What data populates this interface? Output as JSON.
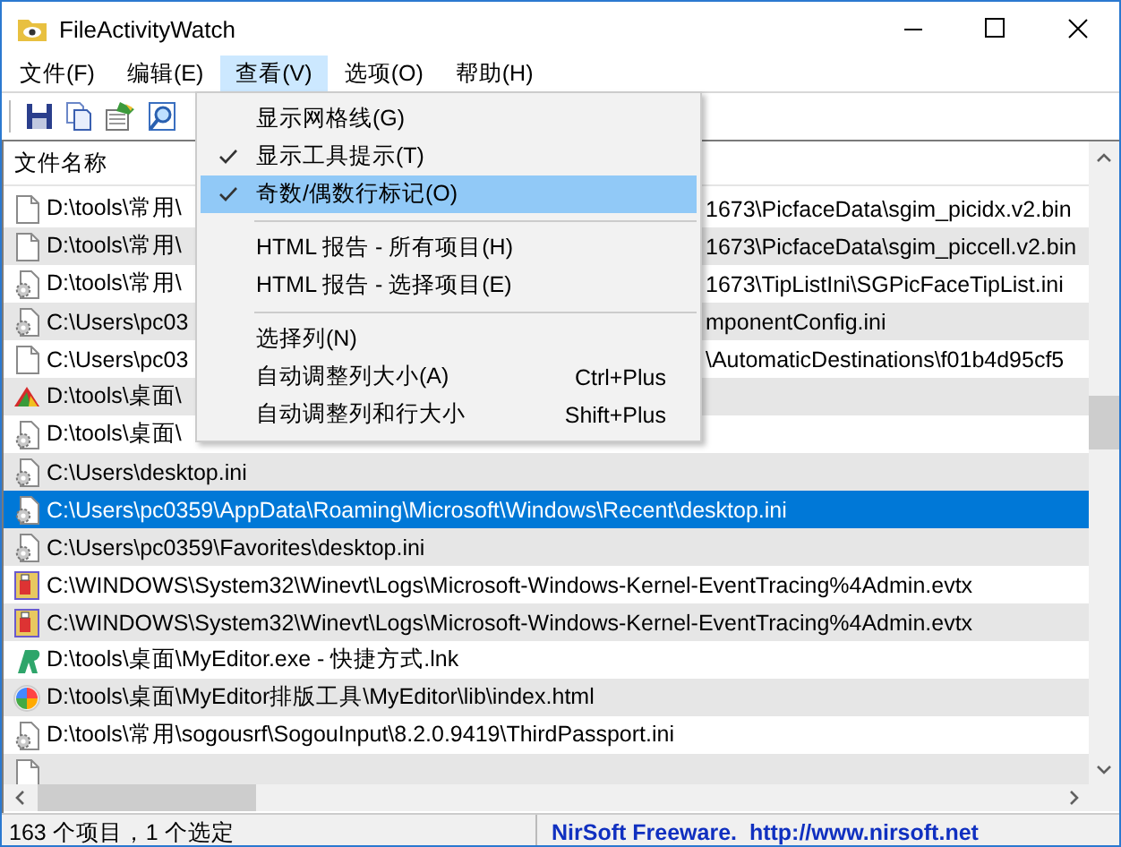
{
  "window": {
    "title": "FileActivityWatch"
  },
  "menu_bar": [
    {
      "label": "文件(F)",
      "selected": false
    },
    {
      "label": "编辑(E)",
      "selected": false
    },
    {
      "label": "查看(V)",
      "selected": true
    },
    {
      "label": "选项(O)",
      "selected": false
    },
    {
      "label": "帮助(H)",
      "selected": false
    }
  ],
  "toolbar": [
    {
      "kind": "save"
    },
    {
      "kind": "copy"
    },
    {
      "kind": "report"
    },
    {
      "kind": "properties"
    }
  ],
  "view_menu": [
    {
      "kind": "item",
      "label": "显示网格线(G)",
      "checked": false,
      "highlighted": false
    },
    {
      "kind": "item",
      "label": "显示工具提示(T)",
      "checked": true,
      "highlighted": false
    },
    {
      "kind": "item",
      "label": "奇数/偶数行标记(O)",
      "checked": true,
      "highlighted": true
    },
    {
      "kind": "separator"
    },
    {
      "kind": "item",
      "label": "HTML 报告 - 所有项目(H)",
      "checked": false,
      "highlighted": false
    },
    {
      "kind": "item",
      "label": "HTML 报告 - 选择项目(E)",
      "checked": false,
      "highlighted": false
    },
    {
      "kind": "separator"
    },
    {
      "kind": "item",
      "label": "选择列(N)",
      "checked": false,
      "highlighted": false
    },
    {
      "kind": "item",
      "label": "自动调整列大小(A)",
      "shortcut": "Ctrl+Plus",
      "checked": false,
      "highlighted": false
    },
    {
      "kind": "item",
      "label": "自动调整列和行大小",
      "shortcut": "Shift+Plus",
      "checked": false,
      "highlighted": false
    }
  ],
  "table": {
    "columns": [
      {
        "label": "文件名称"
      }
    ],
    "rows": [
      {
        "kind": "doc",
        "text": "D:\\tools\\常用\\",
        "text_after_menu": "1673\\PicfaceData\\sgim_picidx.v2.bin",
        "selected": false
      },
      {
        "kind": "doc",
        "text": "D:\\tools\\常用\\",
        "text_after_menu": "1673\\PicfaceData\\sgim_piccell.v2.bin",
        "selected": false
      },
      {
        "kind": "gear",
        "text": "D:\\tools\\常用\\",
        "text_after_menu": "1673\\TipListIni\\SGPicFaceTipList.ini",
        "selected": false
      },
      {
        "kind": "gear",
        "text": "C:\\Users\\pc03",
        "text_after_menu": "mponentConfig.ini",
        "selected": false
      },
      {
        "kind": "doc",
        "text": "C:\\Users\\pc03",
        "text_after_menu": "\\AutomaticDestinations\\f01b4d95cf5",
        "selected": false
      },
      {
        "kind": "app",
        "text": "D:\\tools\\桌面\\",
        "selected": false
      },
      {
        "kind": "gear",
        "text": "D:\\tools\\桌面\\",
        "selected": false
      },
      {
        "kind": "gear",
        "text": "C:\\Users\\desktop.ini",
        "selected": false
      },
      {
        "kind": "gear",
        "text": "C:\\Users\\pc0359\\AppData\\Roaming\\Microsoft\\Windows\\Recent\\desktop.ini",
        "selected": true
      },
      {
        "kind": "gear",
        "text": "C:\\Users\\pc0359\\Favorites\\desktop.ini",
        "selected": false
      },
      {
        "kind": "log",
        "text": "C:\\WINDOWS\\System32\\Winevt\\Logs\\Microsoft-Windows-Kernel-EventTracing%4Admin.evtx",
        "selected": false
      },
      {
        "kind": "log",
        "text": "C:\\WINDOWS\\System32\\Winevt\\Logs\\Microsoft-Windows-Kernel-EventTracing%4Admin.evtx",
        "selected": false
      },
      {
        "kind": "shortcut",
        "text": "D:\\tools\\桌面\\MyEditor.exe - 快捷方式.lnk",
        "selected": false
      },
      {
        "kind": "web",
        "text": "D:\\tools\\桌面\\MyEditor排版工具\\MyEditor\\lib\\index.html",
        "selected": false
      },
      {
        "kind": "gear",
        "text": "D:\\tools\\常用\\sogousrf\\SogouInput\\8.2.0.9419\\ThirdPassport.ini",
        "selected": false
      },
      {
        "kind": "doc",
        "selected": false
      }
    ]
  },
  "status_bar": {
    "count": "163 个项目，1 个选定",
    "credit": "NirSoft Freeware.  http://www.nirsoft.net"
  }
}
